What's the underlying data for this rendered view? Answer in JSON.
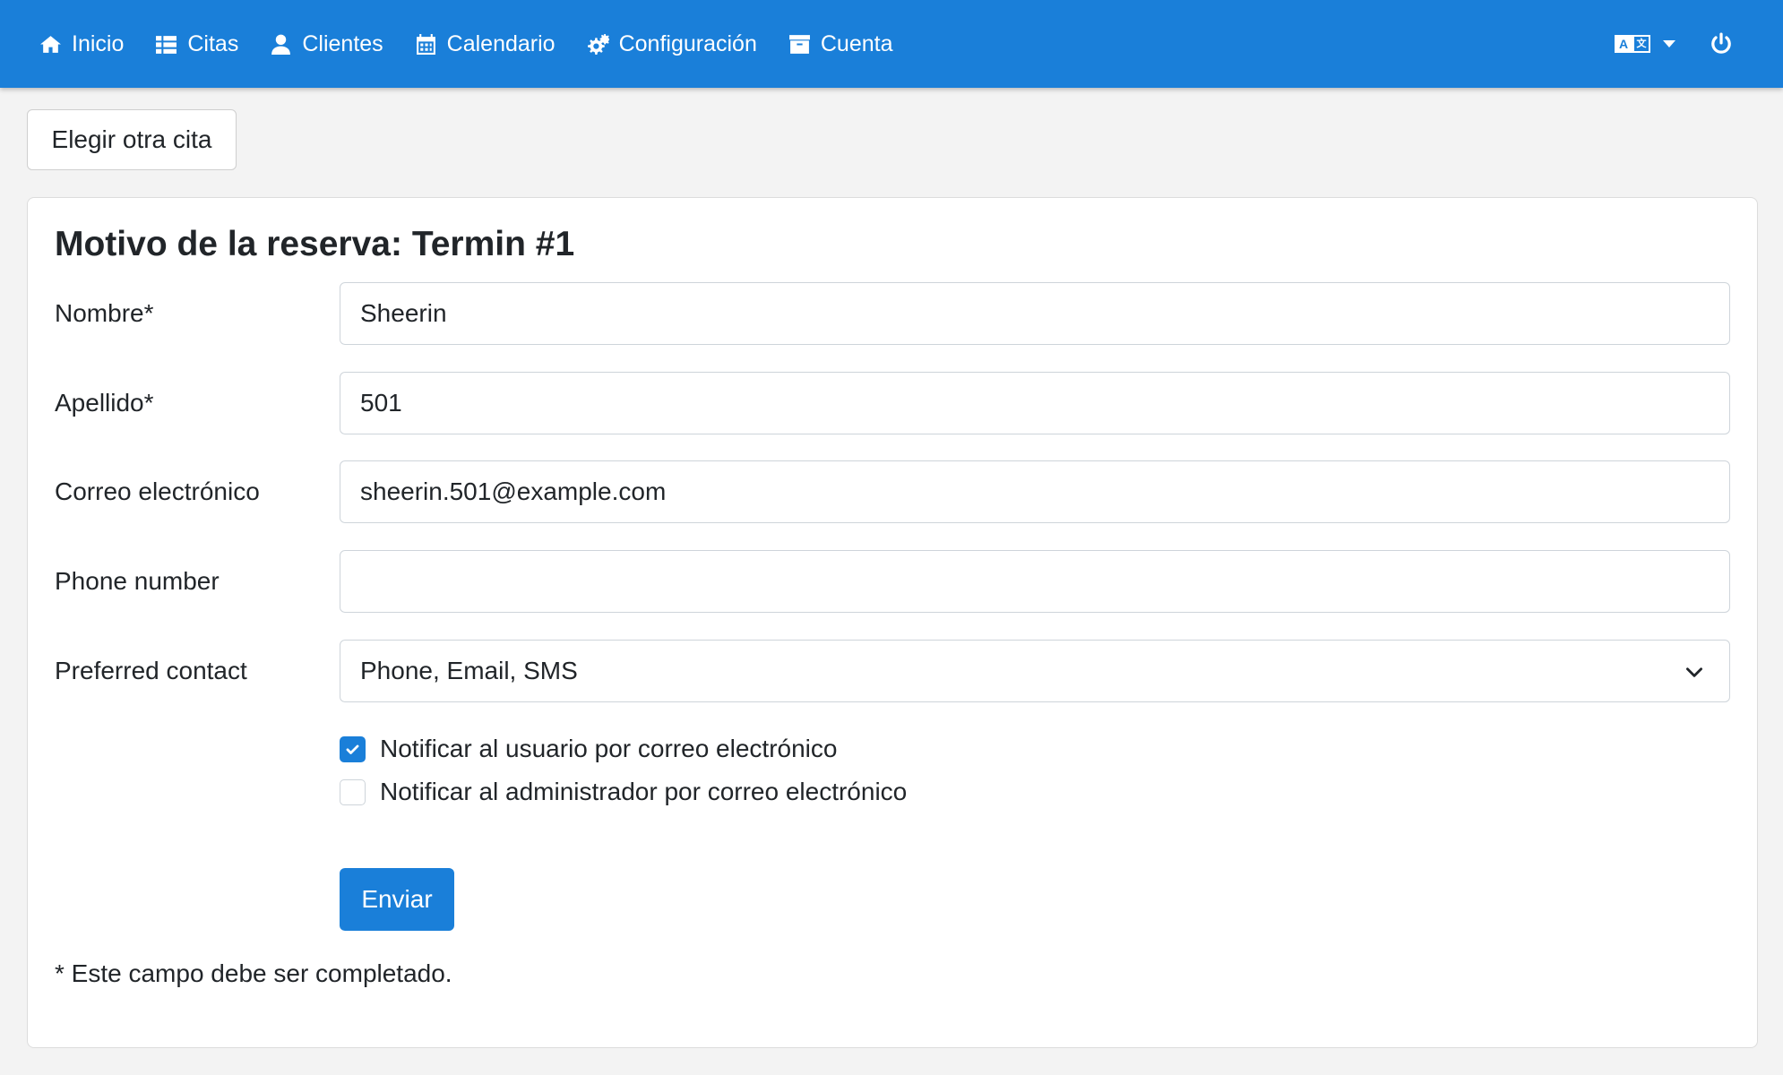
{
  "nav": {
    "items": [
      {
        "label": "Inicio",
        "icon": "home-icon"
      },
      {
        "label": "Citas",
        "icon": "list-icon"
      },
      {
        "label": "Clientes",
        "icon": "user-icon"
      },
      {
        "label": "Calendario",
        "icon": "calendar-icon"
      },
      {
        "label": "Configuración",
        "icon": "cogs-icon"
      },
      {
        "label": "Cuenta",
        "icon": "archive-icon"
      }
    ],
    "language_icon": "language-icon",
    "power_icon": "power-icon"
  },
  "back_button": "Elegir otra cita",
  "form": {
    "title": "Motivo de la reserva: Termin #1",
    "fields": {
      "first_name": {
        "label": "Nombre*",
        "value": "Sheerin"
      },
      "last_name": {
        "label": "Apellido*",
        "value": "501"
      },
      "email": {
        "label": "Correo electrónico",
        "value": "sheerin.501@example.com"
      },
      "phone": {
        "label": "Phone number",
        "value": ""
      },
      "contact": {
        "label": "Preferred contact",
        "value": "Phone, Email, SMS"
      }
    },
    "notify_user": {
      "label": "Notificar al usuario por correo electrónico",
      "checked": true
    },
    "notify_admin": {
      "label": "Notificar al administrador por correo electrónico",
      "checked": false
    },
    "submit_label": "Enviar",
    "footnote": "* Este campo debe ser completado."
  },
  "colors": {
    "accent": "#1a7fd9",
    "background": "#f3f3f3"
  }
}
